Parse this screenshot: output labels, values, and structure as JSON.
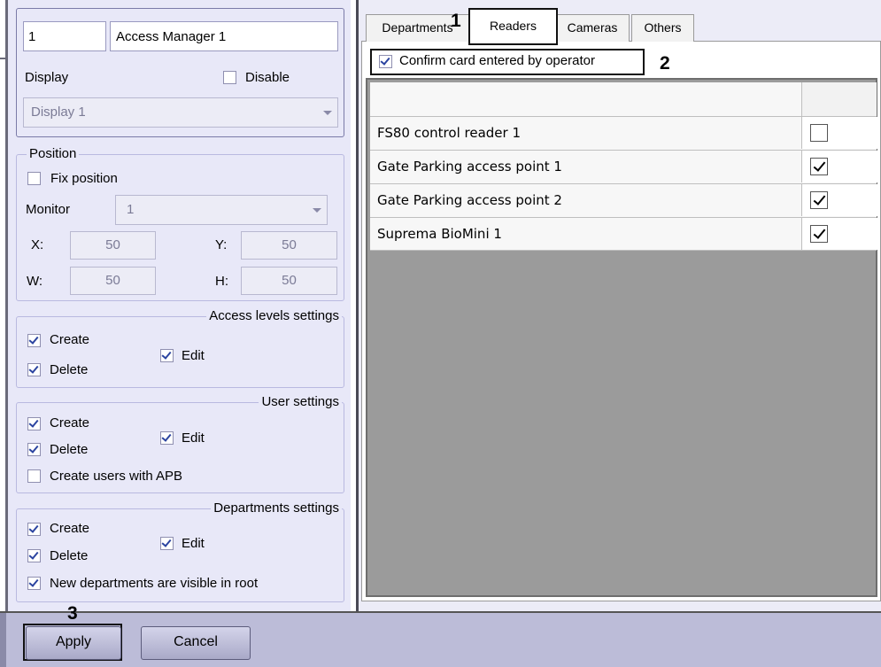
{
  "module": {
    "id": "1",
    "name": "Access Manager 1",
    "display_label": "Display",
    "disable_label": "Disable",
    "disable_checked": false,
    "display_value": "Display 1"
  },
  "position": {
    "legend": "Position",
    "fix_label": "Fix position",
    "fix_checked": false,
    "monitor_label": "Monitor",
    "monitor_value": "1",
    "x_label": "X:",
    "x_value": "50",
    "y_label": "Y:",
    "y_value": "50",
    "w_label": "W:",
    "w_value": "50",
    "h_label": "H:",
    "h_value": "50"
  },
  "access_levels": {
    "legend": "Access levels settings",
    "create_label": "Create",
    "create_checked": true,
    "delete_label": "Delete",
    "delete_checked": true,
    "edit_label": "Edit",
    "edit_checked": true
  },
  "user_settings": {
    "legend": "User settings",
    "create_label": "Create",
    "create_checked": true,
    "delete_label": "Delete",
    "delete_checked": true,
    "edit_label": "Edit",
    "edit_checked": true,
    "apb_label": "Create users with APB",
    "apb_checked": false
  },
  "departments_settings": {
    "legend": "Departments settings",
    "create_label": "Create",
    "create_checked": true,
    "delete_label": "Delete",
    "delete_checked": true,
    "edit_label": "Edit",
    "edit_checked": true,
    "visible_label": "New departments are visible in root",
    "visible_checked": true
  },
  "tabs": [
    {
      "label": "Departments"
    },
    {
      "label": "Readers"
    },
    {
      "label": "Cameras"
    },
    {
      "label": "Others"
    }
  ],
  "active_tab": "Readers",
  "confirm": {
    "label": "Confirm card entered by operator",
    "checked": true
  },
  "readers_table": {
    "rows": [
      {
        "name": "FS80 control reader 1",
        "checked": false
      },
      {
        "name": "Gate Parking access point 1",
        "checked": true
      },
      {
        "name": "Gate Parking access point 2",
        "checked": true
      },
      {
        "name": "Suprema BioMini 1",
        "checked": true
      }
    ]
  },
  "buttons": {
    "apply": "Apply",
    "cancel": "Cancel"
  },
  "annotations": {
    "m1": "1",
    "m2": "2",
    "m3": "3"
  }
}
